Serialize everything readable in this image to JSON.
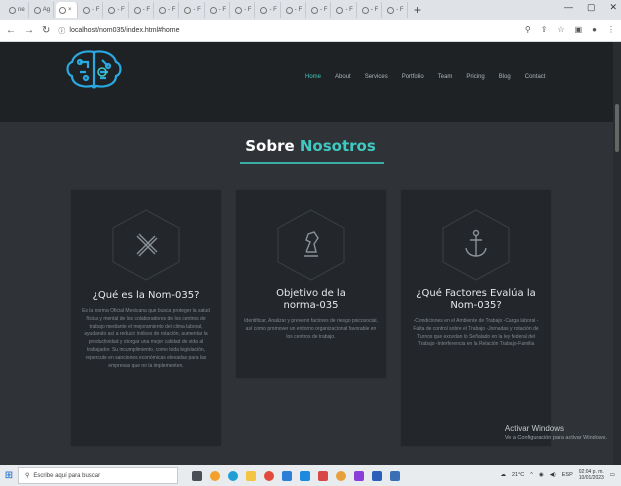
{
  "browser": {
    "tabs": [
      {
        "label": "ne"
      },
      {
        "label": "Ag"
      },
      {
        "label": "×",
        "active": true
      },
      {
        "label": "- F"
      },
      {
        "label": "- F"
      },
      {
        "label": "- F"
      },
      {
        "label": "- F"
      },
      {
        "label": "- F"
      },
      {
        "label": "- F"
      },
      {
        "label": "- F"
      },
      {
        "label": "- F"
      },
      {
        "label": "- F"
      },
      {
        "label": "- F"
      },
      {
        "label": "- F"
      },
      {
        "label": "- F"
      },
      {
        "label": "- F"
      }
    ],
    "url": "localhost/nom035/index.html#home",
    "new_tab": "+",
    "min": "—",
    "max": "▢",
    "close": "✕"
  },
  "site": {
    "menu": [
      "Home",
      "About",
      "Services",
      "Portfolio",
      "Team",
      "Pricing",
      "Blog",
      "Contact"
    ],
    "active_menu": "Home",
    "section_title_1": "Sobre",
    "section_title_2": "Nosotros",
    "cards": [
      {
        "icon": "pencil-ruler-icon",
        "title": "¿Qué es la Nom-035?",
        "text": "Es la norma Oficial Mexicana que busca proteger la salud física y mental de los colaboradores de los centros de trabajo mediante el mejoramiento del clima laboral, ayudando así a reducir índices de rotación, aumentar la productividad y otorgar una mejor calidad de vida al trabajador. Su incumplimiento, como toda legislación, repercute en sanciones económicas elevadas para las empresas que no la implementen."
      },
      {
        "icon": "chess-knight-icon",
        "title": "Objetivo de la norma-035",
        "text": "Identificar, Analizar y prevenir factores de riesgo psicosocial, así como promover un entorno organizacional favorable en los centros de trabajo."
      },
      {
        "icon": "anchor-icon",
        "title": "¿Qué Factores Evalúa la Nom-035?",
        "text": "-Condiciones en el Ambiente de Trabajo -Carga laboral -Falta de control sobre el Trabajo -Jornadas y rotación de Turnos que excedan lo Señalado en la ley federal del Trabajo -Interferencia en la Relación Trabajo-Familia"
      }
    ],
    "activate_title": "Activar Windows",
    "activate_sub": "Ve a Configuración para activar Windows."
  },
  "taskbar": {
    "search_placeholder": "Escribe aquí para buscar",
    "weather": "21°C",
    "lang": "ESP",
    "time": "02:04 p. m.",
    "date": "10/01/2023"
  }
}
